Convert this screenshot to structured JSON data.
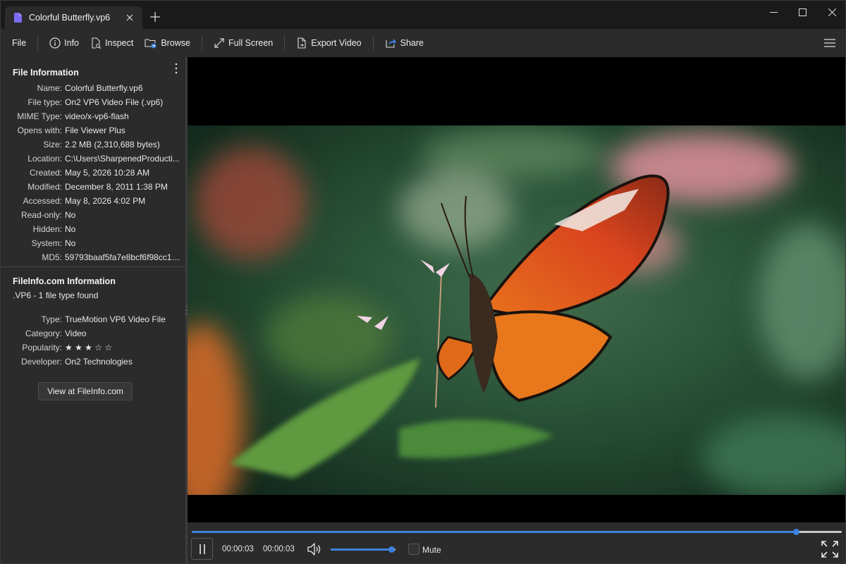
{
  "window": {
    "tab_title": "Colorful Butterfly.vp6",
    "tab_icon": "document-icon",
    "accent": "#7b6cf6"
  },
  "toolbar": {
    "file_label": "File",
    "info_label": "Info",
    "inspect_label": "Inspect",
    "browse_label": "Browse",
    "fullscreen_label": "Full Screen",
    "export_label": "Export Video",
    "share_label": "Share"
  },
  "file_info": {
    "title": "File Information",
    "rows": [
      {
        "key": "Name:",
        "value": "Colorful Butterfly.vp6"
      },
      {
        "key": "File type:",
        "value": "On2 VP6 Video File (.vp6)"
      },
      {
        "key": "MIME Type:",
        "value": "video/x-vp6-flash"
      },
      {
        "key": "Opens with:",
        "value": "File Viewer Plus"
      },
      {
        "key": "Size:",
        "value": "2.2 MB (2,310,688 bytes)"
      },
      {
        "key": "Location:",
        "value": "C:\\Users\\SharpenedProducti..."
      },
      {
        "key": "Created:",
        "value": "May 5, 2026 10:28 AM"
      },
      {
        "key": "Modified:",
        "value": "December 8, 2011 1:38 PM"
      },
      {
        "key": "Accessed:",
        "value": "May 8, 2026 4:02 PM"
      },
      {
        "key": "Read-only:",
        "value": "No"
      },
      {
        "key": "Hidden:",
        "value": "No"
      },
      {
        "key": "System:",
        "value": "No"
      },
      {
        "key": "MD5:",
        "value": "59793baaf5fa7e8bcf6f98cc1e..."
      }
    ]
  },
  "fileinfo_com": {
    "title": "FileInfo.com Information",
    "subtitle": ".VP6 - 1 file type found",
    "rows": [
      {
        "key": "Type:",
        "value": "TrueMotion VP6 Video File"
      },
      {
        "key": "Category:",
        "value": "Video"
      },
      {
        "key": "Popularity:",
        "value": "★ ★ ★ ☆ ☆"
      },
      {
        "key": "Developer:",
        "value": "On2 Technologies"
      }
    ],
    "button_label": "View at FileInfo.com",
    "popularity_stars": 3
  },
  "player": {
    "current_time": "00:00:03",
    "duration": "00:00:03",
    "progress": 0.93,
    "volume": 0.93,
    "mute_label": "Mute",
    "muted": false,
    "accent": "#3b82e0"
  }
}
